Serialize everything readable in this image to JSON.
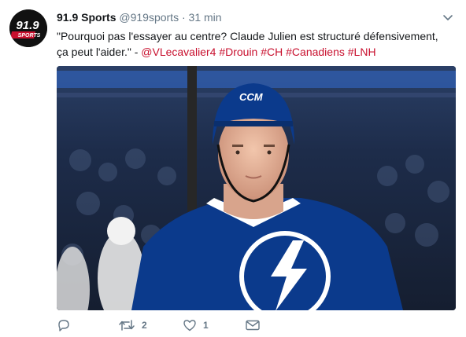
{
  "tweet": {
    "display_name": "91.9 Sports",
    "handle": "@919sports",
    "separator": "·",
    "time": "31 min",
    "text_quote": "\"Pourquoi pas l'essayer au centre? Claude Julien est structuré défensivement, ça peut l'aider.\" - ",
    "mention": "@VLecavalier4",
    "hashtags": [
      "#Drouin",
      "#CH",
      "#Canadiens",
      "#LNH"
    ],
    "avatar_logo": {
      "main": "91.9",
      "sub": "SPORTS"
    },
    "media": {
      "icon": "photo-of-hockey-player",
      "helmet_brand": "CCM",
      "jersey_logo": "lightning-bolt-icon"
    },
    "actions": {
      "reply": {
        "icon": "reply-icon",
        "count": ""
      },
      "retweet": {
        "icon": "retweet-icon",
        "count": "2"
      },
      "like": {
        "icon": "heart-icon",
        "count": "1"
      },
      "dm": {
        "icon": "envelope-icon",
        "count": ""
      }
    }
  },
  "colors": {
    "hashtag": "#c8102e",
    "muted": "#657786",
    "text": "#14171a",
    "jersey_blue": "#0b3a8c"
  }
}
